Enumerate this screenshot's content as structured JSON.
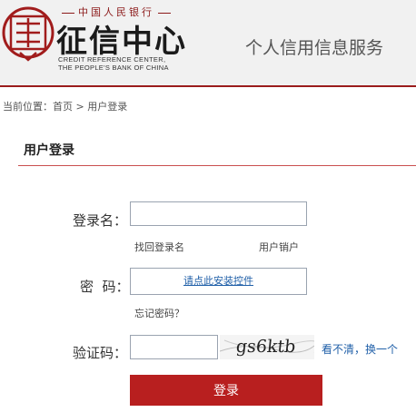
{
  "header": {
    "brand_small": "中国人民银行",
    "brand_main": "征信中心",
    "brand_en_line1": "CREDIT REFERENCE CENTER,",
    "brand_en_line2": "THE PEOPLE'S BANK OF CHINA",
    "tagline": "个人信用信息服务"
  },
  "breadcrumb": {
    "prefix": "当前位置：",
    "home": "首页",
    "separator": " > ",
    "current": "用户登录"
  },
  "section": {
    "title": "用户登录"
  },
  "form": {
    "username_label": "登录名：",
    "username_value": "",
    "recover_link": "找回登录名",
    "deregister_link": "用户销户",
    "password_label": "密  码：",
    "install_control_link": "请点此安装控件",
    "forgot_password_link": "忘记密码？",
    "captcha_label": "验证码：",
    "captcha_value": "",
    "captcha_text": "gs6ktb",
    "refresh_link": "看不清，换一个",
    "login_button": "登录"
  },
  "colors": {
    "brand_red": "#b81f1f",
    "link_blue": "#1f5fa8"
  }
}
